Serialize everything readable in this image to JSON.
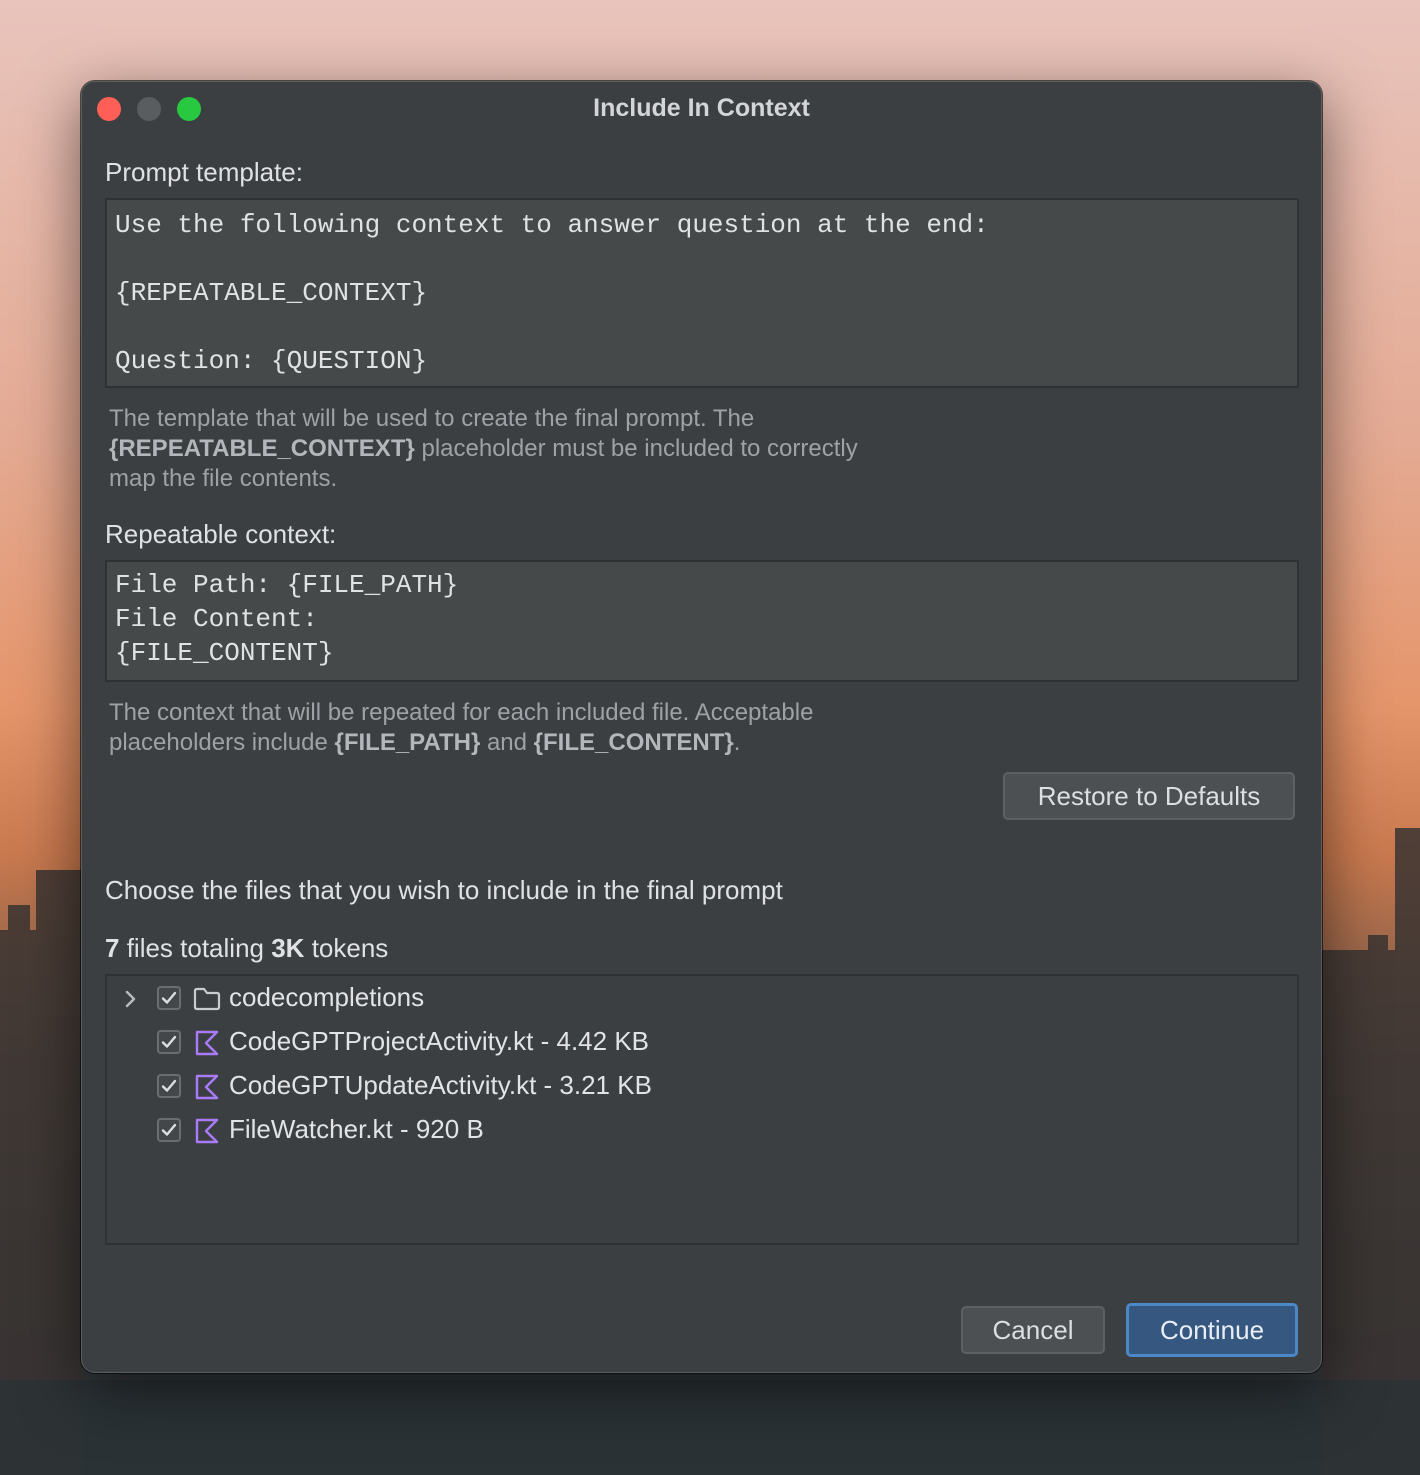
{
  "window": {
    "title": "Include In Context"
  },
  "prompt_template": {
    "label": "Prompt template:",
    "lines": [
      "Use the following context to answer question at the end:",
      "",
      "{REPEATABLE_CONTEXT}",
      "",
      "Question: {QUESTION}"
    ],
    "hint_part1": "The template that will be used to create the final prompt. The",
    "hint_bold": "{REPEATABLE_CONTEXT}",
    "hint_part2": " placeholder must be included to correctly",
    "hint_part3": "map the file contents."
  },
  "repeatable_context": {
    "label": "Repeatable context:",
    "lines": [
      "File Path: {FILE_PATH}",
      "File Content:",
      "{FILE_CONTENT}"
    ],
    "hint_part1": "The context that will be repeated for each included file. Acceptable",
    "hint_part2": "placeholders include ",
    "hint_bold1": "{FILE_PATH}",
    "hint_and": " and ",
    "hint_bold2": "{FILE_CONTENT}",
    "hint_end": "."
  },
  "restore_button": "Restore to Defaults",
  "files_section": {
    "heading": "Choose the files that you wish to include in the final prompt",
    "summary_count": "7",
    "summary_mid": " files totaling ",
    "summary_tokens": "3K",
    "summary_end": " tokens",
    "items": [
      {
        "name": "codecompletions",
        "type": "folder",
        "checked": true
      },
      {
        "name": "CodeGPTProjectActivity.kt - 4.42 KB",
        "type": "kotlin-file",
        "checked": true
      },
      {
        "name": "CodeGPTUpdateActivity.kt - 3.21 KB",
        "type": "kotlin-file",
        "checked": true
      },
      {
        "name": "FileWatcher.kt - 920 B",
        "type": "kotlin-file",
        "checked": true
      }
    ]
  },
  "footer": {
    "cancel": "Cancel",
    "continue": "Continue"
  },
  "colors": {
    "window_bg": "#3c3f41",
    "primary_button": "#365880",
    "primary_border": "#4a88c7",
    "kotlin_icon": "#a97bff"
  }
}
